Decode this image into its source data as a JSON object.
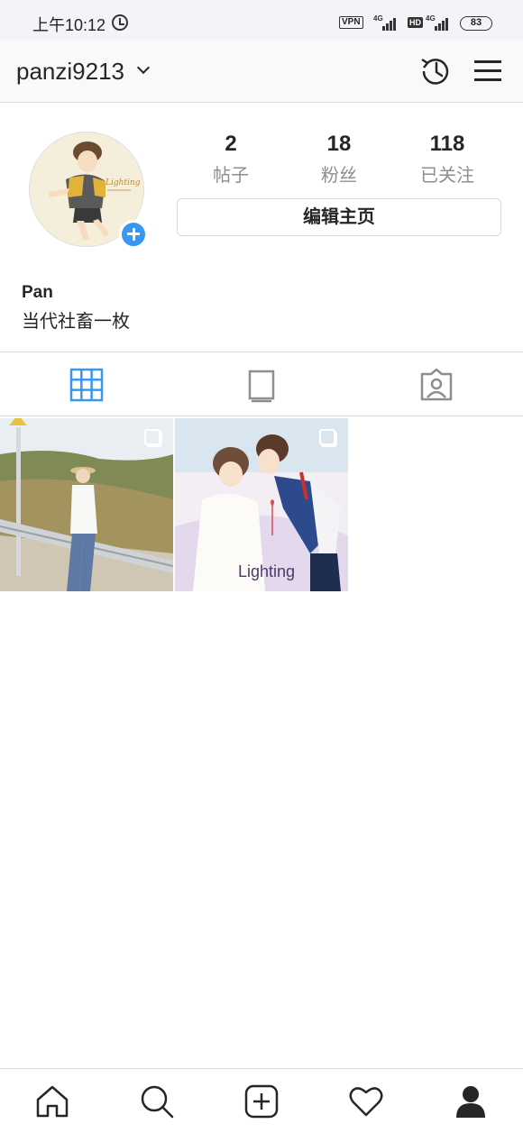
{
  "status_bar": {
    "time": "上午10:12",
    "vpn": "VPN",
    "network_1": "4G",
    "network_2": "4G",
    "hd": "HD",
    "battery": "83"
  },
  "header": {
    "username": "panzi9213"
  },
  "profile": {
    "posts_count": "2",
    "posts_label": "帖子",
    "followers_count": "18",
    "followers_label": "粉丝",
    "following_count": "118",
    "following_label": "已关注",
    "edit_button": "编辑主页",
    "name": "Pan",
    "bio": "当代社畜一枚"
  },
  "posts": [
    {
      "caption": ""
    },
    {
      "caption": "Lighting"
    }
  ],
  "colors": {
    "accent": "#3897f0",
    "text": "#262626",
    "muted": "#8e8e8e",
    "border": "#dbdbdb"
  },
  "icons": [
    "alarm-icon",
    "history-icon",
    "menu-icon",
    "grid-icon",
    "igtv-icon",
    "tagged-icon",
    "home-icon",
    "search-icon",
    "add-post-icon",
    "heart-icon",
    "profile-icon"
  ]
}
